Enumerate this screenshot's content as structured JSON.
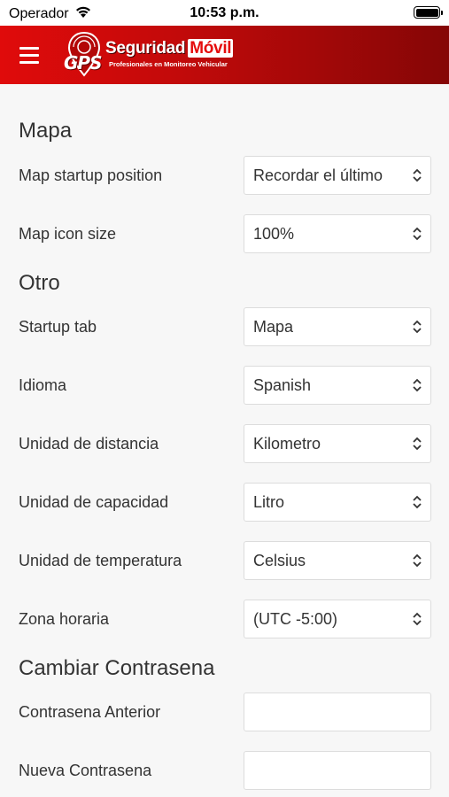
{
  "status_bar": {
    "carrier": "Operador",
    "time": "10:53 p.m."
  },
  "header": {
    "logo_gps": "GPS",
    "logo_brand_1": "Seguridad",
    "logo_brand_2": "Móvil",
    "logo_tagline": "Profesionales en Monitoreo Vehicular",
    "colors": {
      "bar_start": "#e00b0b",
      "bar_end": "#850606"
    }
  },
  "sections": {
    "mapa": {
      "title": "Mapa",
      "rows": [
        {
          "label": "Map startup position",
          "value": "Recordar el último"
        },
        {
          "label": "Map icon size",
          "value": "100%"
        }
      ]
    },
    "otro": {
      "title": "Otro",
      "rows": [
        {
          "label": "Startup tab",
          "value": "Mapa"
        },
        {
          "label": "Idioma",
          "value": "Spanish"
        },
        {
          "label": "Unidad de distancia",
          "value": "Kilometro"
        },
        {
          "label": "Unidad de capacidad",
          "value": "Litro"
        },
        {
          "label": "Unidad de temperatura",
          "value": "Celsius"
        },
        {
          "label": "Zona horaria",
          "value": "(UTC -5:00)"
        }
      ]
    },
    "password": {
      "title": "Cambiar Contrasena",
      "fields": [
        {
          "label": "Contrasena Anterior",
          "value": ""
        },
        {
          "label": "Nueva Contrasena",
          "value": ""
        }
      ]
    }
  }
}
